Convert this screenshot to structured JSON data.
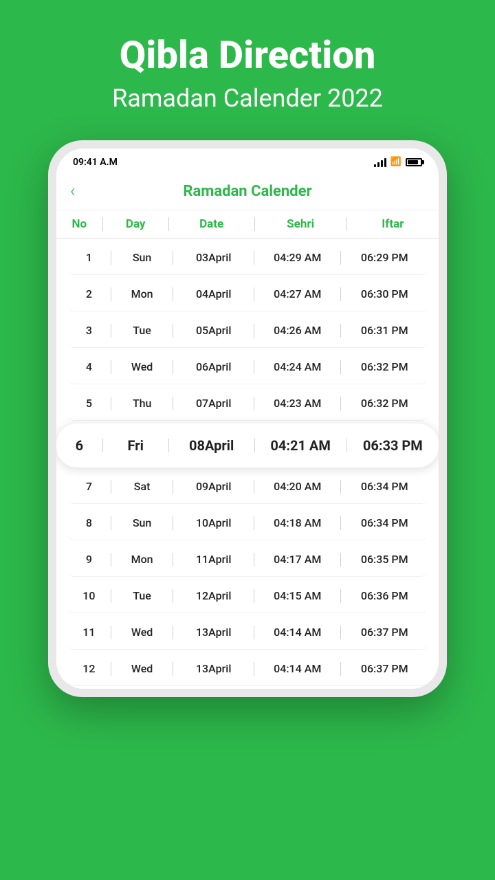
{
  "app": {
    "hero_title": "Qibla Direction",
    "hero_subtitle": "Ramadan Calender 2022",
    "status_time": "09:41 A.M",
    "screen_title": "Ramadan Calender",
    "back_label": "‹"
  },
  "table": {
    "headers": {
      "no": "No",
      "day": "Day",
      "date": "Date",
      "sehri": "Sehri",
      "iftar": "Iftar"
    },
    "rows": [
      {
        "no": "1",
        "day": "Sun",
        "date": "03April",
        "sehri": "04:29 AM",
        "iftar": "06:29 PM",
        "highlighted": false
      },
      {
        "no": "2",
        "day": "Mon",
        "date": "04April",
        "sehri": "04:27 AM",
        "iftar": "06:30 PM",
        "highlighted": false
      },
      {
        "no": "3",
        "day": "Tue",
        "date": "05April",
        "sehri": "04:26 AM",
        "iftar": "06:31 PM",
        "highlighted": false
      },
      {
        "no": "4",
        "day": "Wed",
        "date": "06April",
        "sehri": "04:24 AM",
        "iftar": "06:32 PM",
        "highlighted": false
      },
      {
        "no": "5",
        "day": "Thu",
        "date": "07April",
        "sehri": "04:23 AM",
        "iftar": "06:32 PM",
        "highlighted": false
      },
      {
        "no": "6",
        "day": "Fri",
        "date": "08April",
        "sehri": "04:21 AM",
        "iftar": "06:33 PM",
        "highlighted": true
      },
      {
        "no": "7",
        "day": "Sat",
        "date": "09April",
        "sehri": "04:20 AM",
        "iftar": "06:34 PM",
        "highlighted": false
      },
      {
        "no": "8",
        "day": "Sun",
        "date": "10April",
        "sehri": "04:18 AM",
        "iftar": "06:34 PM",
        "highlighted": false
      },
      {
        "no": "9",
        "day": "Mon",
        "date": "11April",
        "sehri": "04:17 AM",
        "iftar": "06:35 PM",
        "highlighted": false
      },
      {
        "no": "10",
        "day": "Tue",
        "date": "12April",
        "sehri": "04:15 AM",
        "iftar": "06:36 PM",
        "highlighted": false
      },
      {
        "no": "11",
        "day": "Wed",
        "date": "13April",
        "sehri": "04:14 AM",
        "iftar": "06:37 PM",
        "highlighted": false
      },
      {
        "no": "12",
        "day": "Wed",
        "date": "13April",
        "sehri": "04:14 AM",
        "iftar": "06:37 PM",
        "highlighted": false
      }
    ]
  }
}
